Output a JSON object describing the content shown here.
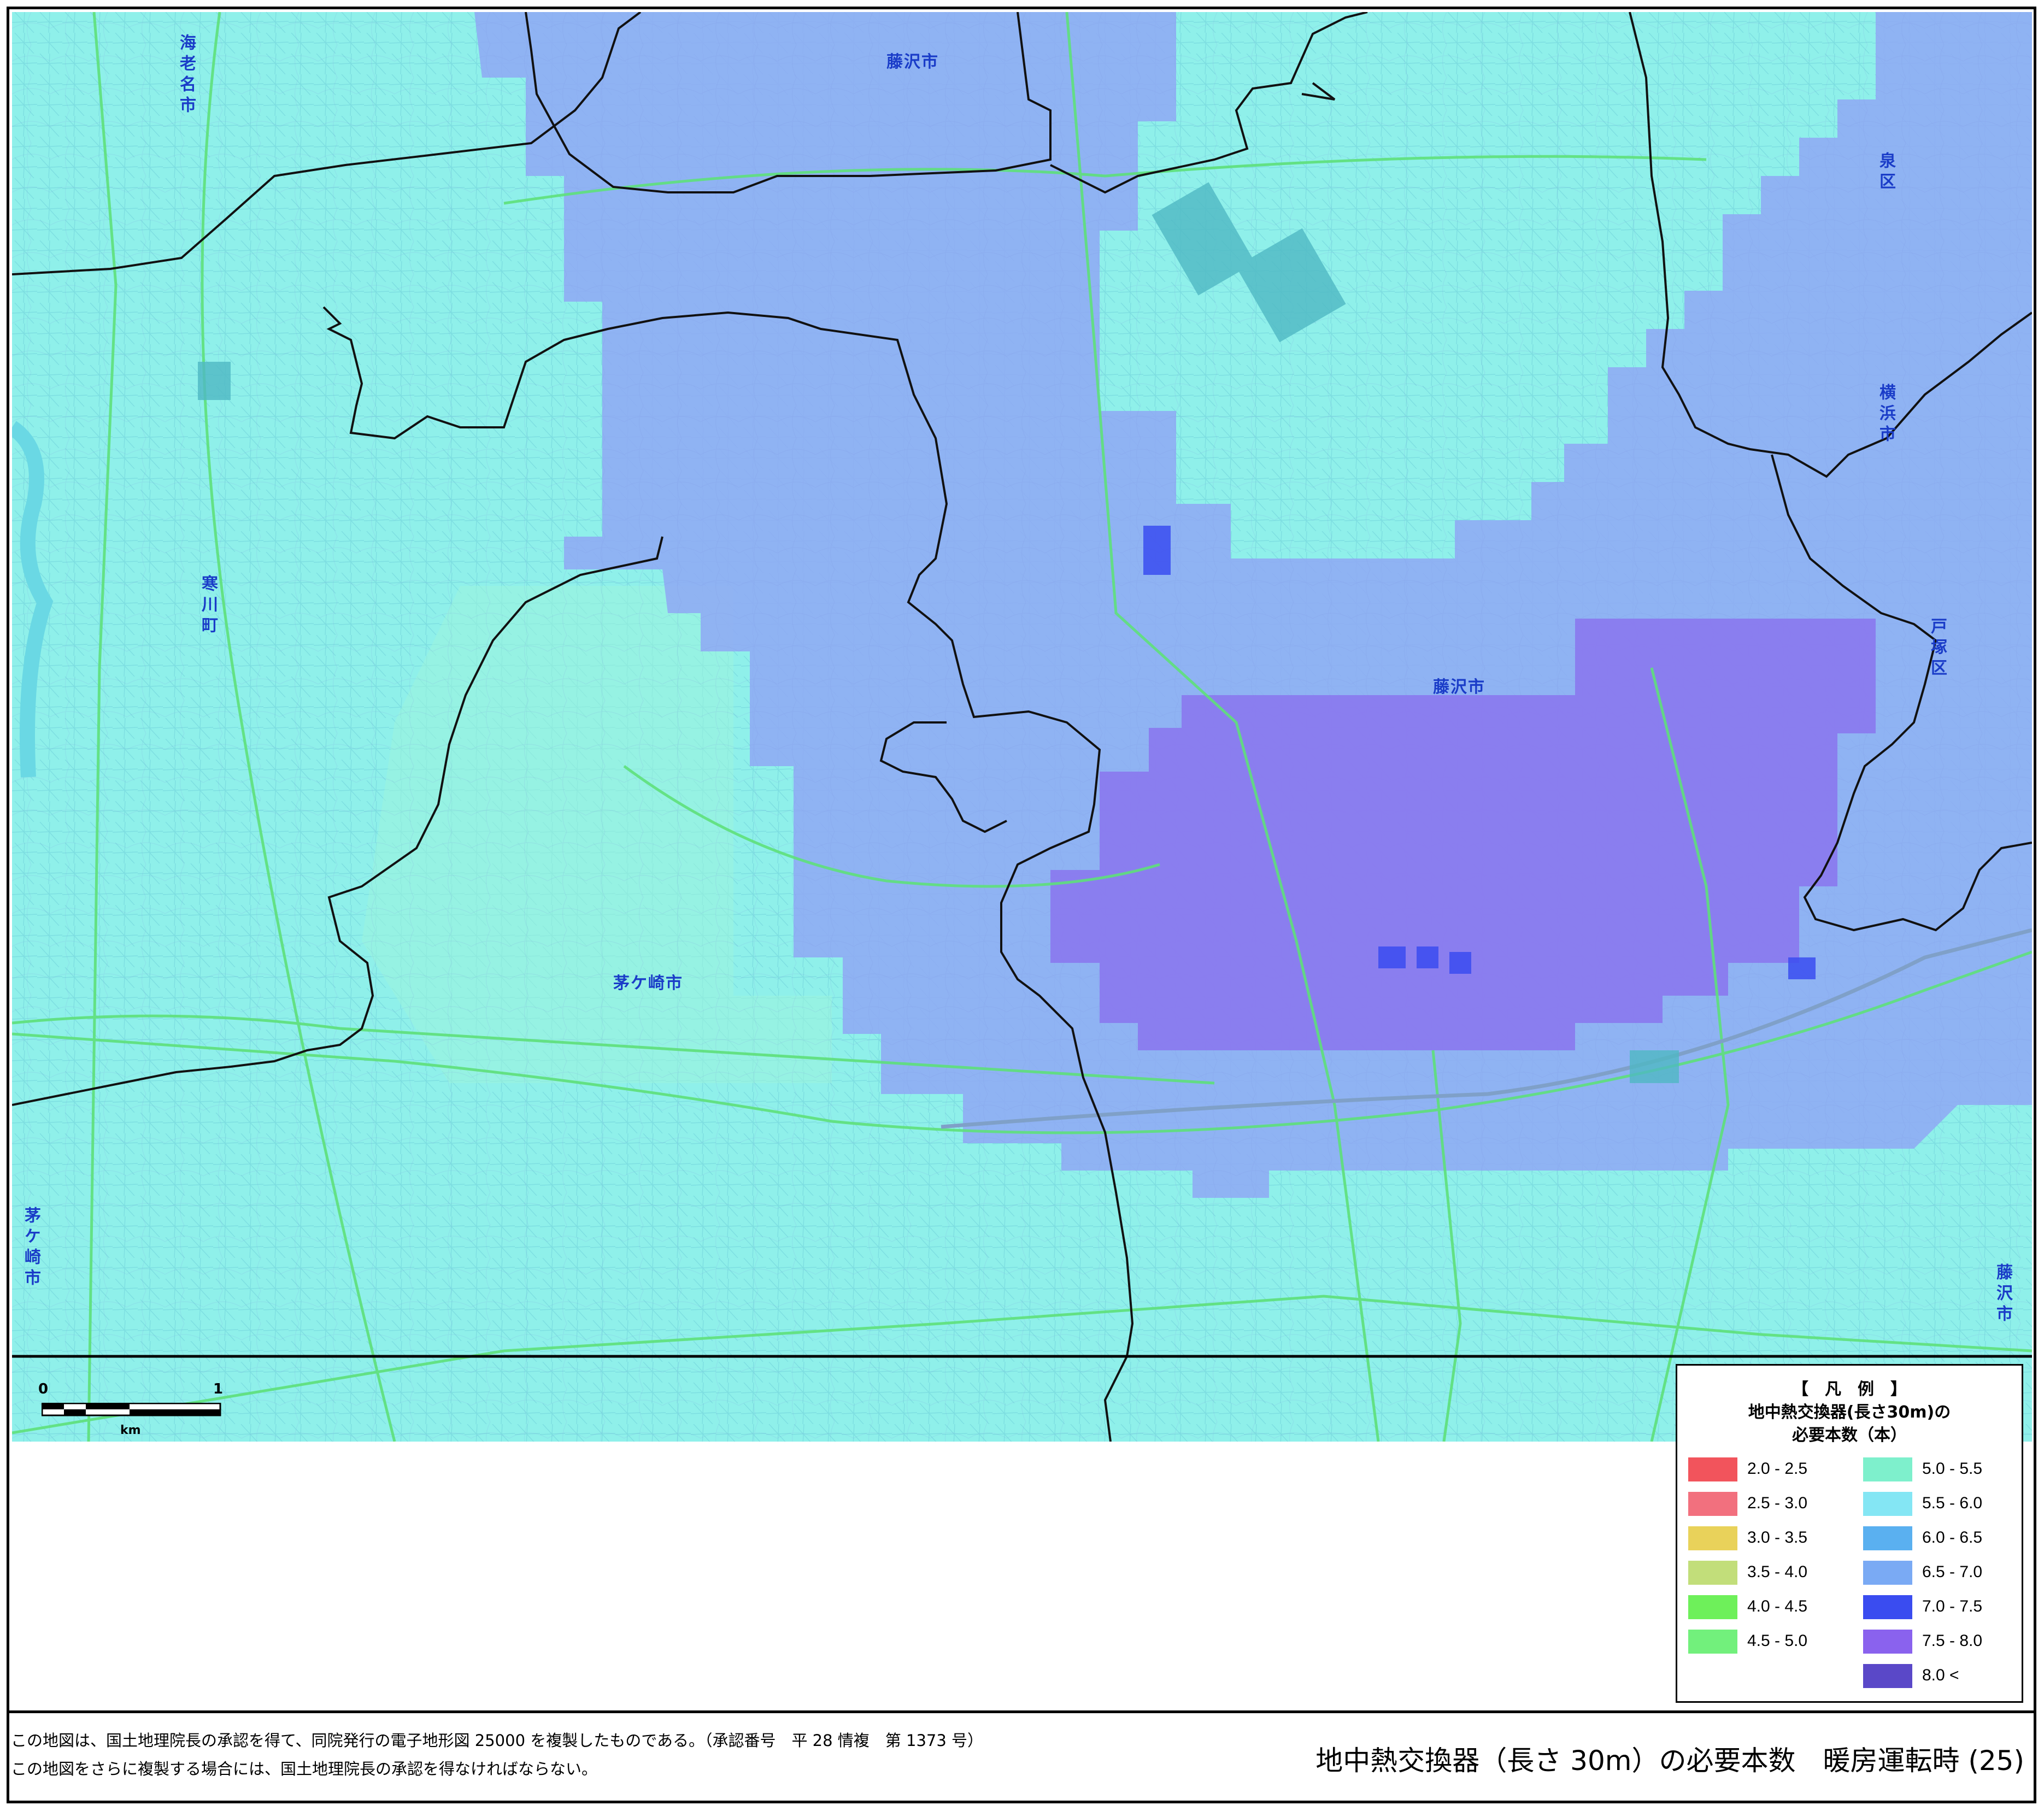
{
  "map_title": "地中熱交換器（長さ 30m）の必要本数　暖房運転時 (25)",
  "place_names": {
    "ebina": "海老名市",
    "fujisawa_top": "藤沢市",
    "fujisawa_center": "藤沢市",
    "fujisawa_right": "藤沢市",
    "samukawa": "寒川町",
    "chigasaki_center": "茅ケ崎市",
    "chigasaki_left": "茅ケ崎市",
    "izumi": "泉区",
    "yokohama": "横浜市",
    "totsuka": "戸塚区"
  },
  "scale_bar": {
    "label_start": "0",
    "label_end": "1",
    "unit": "km"
  },
  "legend": {
    "title_line1": "【　凡　例　】",
    "title_line2": "地中熱交換器(長さ30m)の",
    "title_line3": "必要本数（本）",
    "left_items": [
      {
        "label": "2.0 - 2.5",
        "color": "#f2545c"
      },
      {
        "label": "2.5 - 3.0",
        "color": "#f2707e"
      },
      {
        "label": "3.0 - 3.5",
        "color": "#e9d25a"
      },
      {
        "label": "3.5 - 4.0",
        "color": "#c2de7a"
      },
      {
        "label": "4.0 - 4.5",
        "color": "#6ef05a"
      },
      {
        "label": "4.5 - 5.0",
        "color": "#72f07c"
      }
    ],
    "right_items": [
      {
        "label": "5.0 - 5.5",
        "color": "#7ef0cc"
      },
      {
        "label": "5.5 - 6.0",
        "color": "#84e6f4"
      },
      {
        "label": "6.0 - 6.5",
        "color": "#5ab0f0"
      },
      {
        "label": "6.5 - 7.0",
        "color": "#7aaaf4"
      },
      {
        "label": "7.0 - 7.5",
        "color": "#3a4cf0"
      },
      {
        "label": "7.5 - 8.0",
        "color": "#8a62ee"
      },
      {
        "label": "8.0 <",
        "color": "#5a48c8"
      }
    ]
  },
  "footnote_line1": "この地図は、国土地理院長の承認を得て、同院発行の電子地形図 25000 を複製したものである。（承認番号　平 28 情複　第 1373 号）",
  "footnote_line2": "この地図をさらに複製する場合には、国土地理院長の承認を得なければならない。",
  "colors": {
    "base_cyan": "#8ff0ea",
    "blue_zone": "#8fa8f4",
    "purple_zone": "#8a78ee",
    "boundary": "#111111",
    "road_green": "#5ee07a"
  }
}
